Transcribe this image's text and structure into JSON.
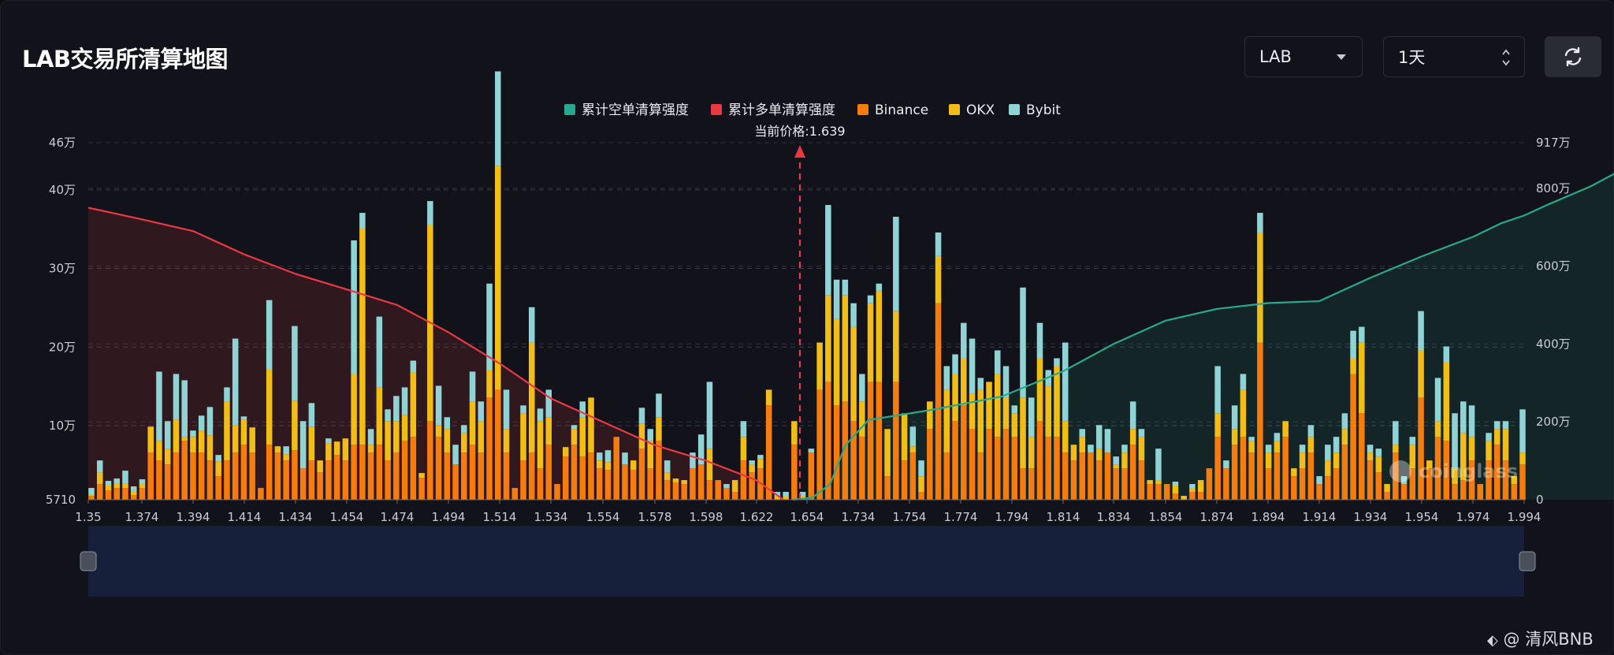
{
  "header": {
    "title": "LAB交易所清算地图",
    "symbol_select": "LAB",
    "range_select": "1天"
  },
  "legend": [
    {
      "label": "累计空单清算强度",
      "color": "#26a98e"
    },
    {
      "label": "累计多单清算强度",
      "color": "#ea3943"
    },
    {
      "label": "Binance",
      "color": "#f57c0d"
    },
    {
      "label": "OKX",
      "color": "#f2be16"
    },
    {
      "label": "Bybit",
      "color": "#8fd3d5"
    }
  ],
  "current_price_label": "当前价格:1.639",
  "watermark_text": "coinglass",
  "footer_watermark": "@ 清风BNB",
  "icons": {
    "refresh": "refresh-icon",
    "dropdown": "chevron-down-icon",
    "footer": "binance-square-icon"
  },
  "chart_data": {
    "type": "bar",
    "title": "LAB交易所清算地图",
    "current_price": 1.639,
    "x_ticks": [
      "1.35",
      "1.374",
      "1.394",
      "1.414",
      "1.434",
      "1.454",
      "1.474",
      "1.494",
      "1.514",
      "1.534",
      "1.554",
      "1.578",
      "1.598",
      "1.622",
      "1.654",
      "1.734",
      "1.754",
      "1.774",
      "1.794",
      "1.814",
      "1.834",
      "1.854",
      "1.874",
      "1.894",
      "1.914",
      "1.934",
      "1.954",
      "1.974",
      "1.994"
    ],
    "y_left_ticks": [
      "5710",
      "10万",
      "20万",
      "30万",
      "40万",
      "46万"
    ],
    "y_left_ticks_values": [
      5710,
      100000,
      200000,
      300000,
      400000,
      460000
    ],
    "y_right_ticks": [
      "0",
      "200万",
      "400万",
      "600万",
      "800万",
      "917万"
    ],
    "y_right_ticks_values": [
      0,
      2000000,
      4000000,
      6000000,
      8000000,
      9170000
    ],
    "ylim_left": [
      5710,
      460000
    ],
    "ylim_right": [
      0,
      9170000
    ],
    "stack_series": [
      "Binance",
      "OKX",
      "Bybit"
    ],
    "bars": [
      [
        5,
        2,
        8
      ],
      [
        20,
        15,
        15
      ],
      [
        12,
        6,
        6
      ],
      [
        15,
        6,
        6
      ],
      [
        15,
        6,
        16
      ],
      [
        6,
        5,
        6
      ],
      [
        15,
        5,
        6
      ],
      [
        60,
        33,
        0
      ],
      [
        50,
        25,
        88
      ],
      [
        45,
        20,
        35
      ],
      [
        60,
        42,
        58
      ],
      [
        75,
        5,
        72
      ],
      [
        60,
        20,
        8
      ],
      [
        60,
        28,
        19
      ],
      [
        50,
        32,
        36
      ],
      [
        30,
        19,
        8
      ],
      [
        50,
        75,
        18
      ],
      [
        60,
        35,
        110
      ],
      [
        70,
        32,
        4
      ],
      [
        60,
        32,
        0
      ],
      [
        15,
        0,
        0
      ],
      [
        70,
        96,
        88
      ],
      [
        60,
        8,
        0
      ],
      [
        50,
        8,
        10
      ],
      [
        63,
        63,
        95
      ],
      [
        40,
        0,
        60
      ],
      [
        50,
        43,
        30
      ],
      [
        35,
        15,
        0
      ],
      [
        50,
        22,
        6
      ],
      [
        57,
        17,
        0
      ],
      [
        50,
        28,
        0
      ],
      [
        70,
        90,
        170
      ],
      [
        70,
        275,
        20
      ],
      [
        60,
        10,
        20
      ],
      [
        70,
        73,
        90
      ],
      [
        50,
        50,
        15
      ],
      [
        60,
        40,
        32
      ],
      [
        75,
        33,
        35
      ],
      [
        80,
        82,
        15
      ],
      [
        28,
        6,
        0
      ],
      [
        100,
        250,
        30
      ],
      [
        80,
        15,
        50
      ],
      [
        60,
        30,
        15
      ],
      [
        45,
        0,
        25
      ],
      [
        60,
        25,
        10
      ],
      [
        70,
        55,
        38
      ],
      [
        60,
        40,
        25
      ],
      [
        130,
        35,
        110
      ],
      [
        140,
        285,
        120
      ],
      [
        60,
        30,
        50
      ],
      [
        15,
        0,
        0
      ],
      [
        50,
        60,
        10
      ],
      [
        60,
        140,
        45
      ],
      [
        40,
        60,
        16
      ],
      [
        70,
        35,
        35
      ],
      [
        20,
        0,
        0
      ],
      [
        55,
        12,
        0
      ],
      [
        70,
        20,
        5
      ],
      [
        55,
        50,
        20
      ],
      [
        60,
        70,
        0
      ],
      [
        40,
        10,
        10
      ],
      [
        38,
        10,
        15
      ],
      [
        80,
        0,
        0
      ],
      [
        45,
        0,
        15
      ],
      [
        38,
        12,
        0
      ],
      [
        65,
        32,
        20
      ],
      [
        40,
        35,
        15
      ],
      [
        75,
        30,
        30
      ],
      [
        25,
        10,
        15
      ],
      [
        22,
        5,
        0
      ],
      [
        20,
        5,
        0
      ],
      [
        40,
        0,
        20
      ],
      [
        45,
        0,
        38
      ],
      [
        25,
        40,
        85
      ],
      [
        25,
        0,
        0
      ],
      [
        15,
        0,
        5
      ],
      [
        10,
        15,
        0
      ],
      [
        50,
        30,
        20
      ],
      [
        35,
        10,
        5
      ],
      [
        40,
        12,
        5
      ],
      [
        120,
        20,
        0
      ],
      [
        0,
        5,
        5
      ],
      [
        0,
        5,
        5
      ],
      [
        70,
        30,
        0
      ],
      [
        0,
        5,
        5
      ],
      [
        60,
        0,
        5
      ],
      [
        140,
        60,
        0
      ],
      [
        150,
        110,
        115
      ],
      [
        120,
        110,
        50
      ],
      [
        125,
        135,
        20
      ],
      [
        100,
        120,
        30
      ],
      [
        80,
        45,
        35
      ],
      [
        150,
        100,
        10
      ],
      [
        150,
        115,
        10
      ],
      [
        30,
        60,
        0
      ],
      [
        150,
        90,
        120
      ],
      [
        50,
        60,
        0
      ],
      [
        60,
        8,
        25
      ],
      [
        10,
        20,
        20
      ],
      [
        90,
        35,
        0
      ],
      [
        250,
        60,
        30
      ],
      [
        60,
        80,
        30
      ],
      [
        100,
        60,
        25
      ],
      [
        120,
        60,
        45
      ],
      [
        90,
        45,
        70
      ],
      [
        60,
        80,
        15
      ],
      [
        90,
        60,
        0
      ],
      [
        80,
        80,
        30
      ],
      [
        90,
        40,
        40
      ],
      [
        80,
        30,
        10
      ],
      [
        40,
        90,
        140
      ],
      [
        40,
        40,
        50
      ],
      [
        100,
        80,
        45
      ],
      [
        80,
        65,
        20
      ],
      [
        80,
        90,
        10
      ],
      [
        60,
        40,
        100
      ],
      [
        50,
        20,
        0
      ],
      [
        60,
        20,
        10
      ],
      [
        60,
        0,
        10
      ],
      [
        50,
        15,
        30
      ],
      [
        60,
        0,
        30
      ],
      [
        40,
        5,
        10
      ],
      [
        40,
        20,
        10
      ],
      [
        70,
        20,
        35
      ],
      [
        50,
        30,
        10
      ],
      [
        20,
        5,
        0
      ],
      [
        20,
        5,
        40
      ],
      [
        20,
        0,
        0
      ],
      [
        8,
        10,
        5
      ],
      [
        0,
        5,
        0
      ],
      [
        10,
        5,
        5
      ],
      [
        10,
        15,
        0
      ],
      [
        40,
        0,
        0
      ],
      [
        80,
        30,
        60
      ],
      [
        40,
        0,
        10
      ],
      [
        70,
        20,
        30
      ],
      [
        80,
        60,
        20
      ],
      [
        60,
        15,
        5
      ],
      [
        200,
        140,
        25
      ],
      [
        40,
        20,
        10
      ],
      [
        60,
        15,
        10
      ],
      [
        80,
        20,
        0
      ],
      [
        30,
        10,
        0
      ],
      [
        40,
        20,
        10
      ],
      [
        60,
        20,
        15
      ],
      [
        20,
        0,
        10
      ],
      [
        30,
        20,
        20
      ],
      [
        40,
        20,
        20
      ],
      [
        70,
        20,
        20
      ],
      [
        160,
        20,
        35
      ],
      [
        110,
        90,
        20
      ],
      [
        50,
        10,
        10
      ],
      [
        35,
        20,
        10
      ],
      [
        10,
        10,
        0
      ],
      [
        60,
        10,
        30
      ],
      [
        20,
        0,
        10
      ],
      [
        40,
        30,
        10
      ],
      [
        130,
        60,
        50
      ],
      [
        40,
        10,
        0
      ],
      [
        80,
        20,
        55
      ],
      [
        75,
        100,
        20
      ],
      [
        20,
        20,
        70
      ],
      [
        25,
        60,
        40
      ],
      [
        50,
        30,
        40
      ],
      [
        20,
        0,
        0
      ],
      [
        50,
        25,
        10
      ],
      [
        70,
        20,
        10
      ],
      [
        50,
        40,
        10
      ],
      [
        20,
        10,
        0
      ],
      [
        45,
        15,
        55
      ]
    ],
    "short_cumulative": [
      [
        1.645,
        0
      ],
      [
        1.662,
        50000
      ],
      [
        1.69,
        400000
      ],
      [
        1.714,
        1400000
      ],
      [
        1.738,
        2050000
      ],
      [
        1.762,
        2300000
      ],
      [
        1.79,
        2650000
      ],
      [
        1.814,
        3300000
      ],
      [
        1.834,
        4000000
      ],
      [
        1.854,
        4600000
      ],
      [
        1.874,
        4900000
      ],
      [
        1.894,
        5050000
      ],
      [
        1.914,
        5100000
      ],
      [
        1.934,
        5700000
      ],
      [
        1.954,
        6250000
      ],
      [
        1.974,
        6750000
      ],
      [
        1.985,
        7100000
      ],
      [
        1.994,
        7300000
      ],
      [
        2.004,
        7600000
      ],
      [
        2.02,
        8050000
      ],
      [
        2.03,
        8400000
      ],
      [
        2.044,
        8450000
      ],
      [
        2.055,
        8550000
      ],
      [
        2.07,
        8600000
      ],
      [
        2.08,
        8800000
      ],
      [
        2.094,
        8900000
      ]
    ],
    "long_cumulative": [
      [
        1.35,
        7500000
      ],
      [
        1.374,
        7200000
      ],
      [
        1.394,
        6900000
      ],
      [
        1.414,
        6300000
      ],
      [
        1.434,
        5800000
      ],
      [
        1.454,
        5400000
      ],
      [
        1.474,
        5000000
      ],
      [
        1.494,
        4300000
      ],
      [
        1.514,
        3500000
      ],
      [
        1.534,
        2600000
      ],
      [
        1.554,
        2000000
      ],
      [
        1.578,
        1400000
      ],
      [
        1.598,
        1000000
      ],
      [
        1.622,
        500000
      ],
      [
        1.639,
        0
      ]
    ]
  }
}
